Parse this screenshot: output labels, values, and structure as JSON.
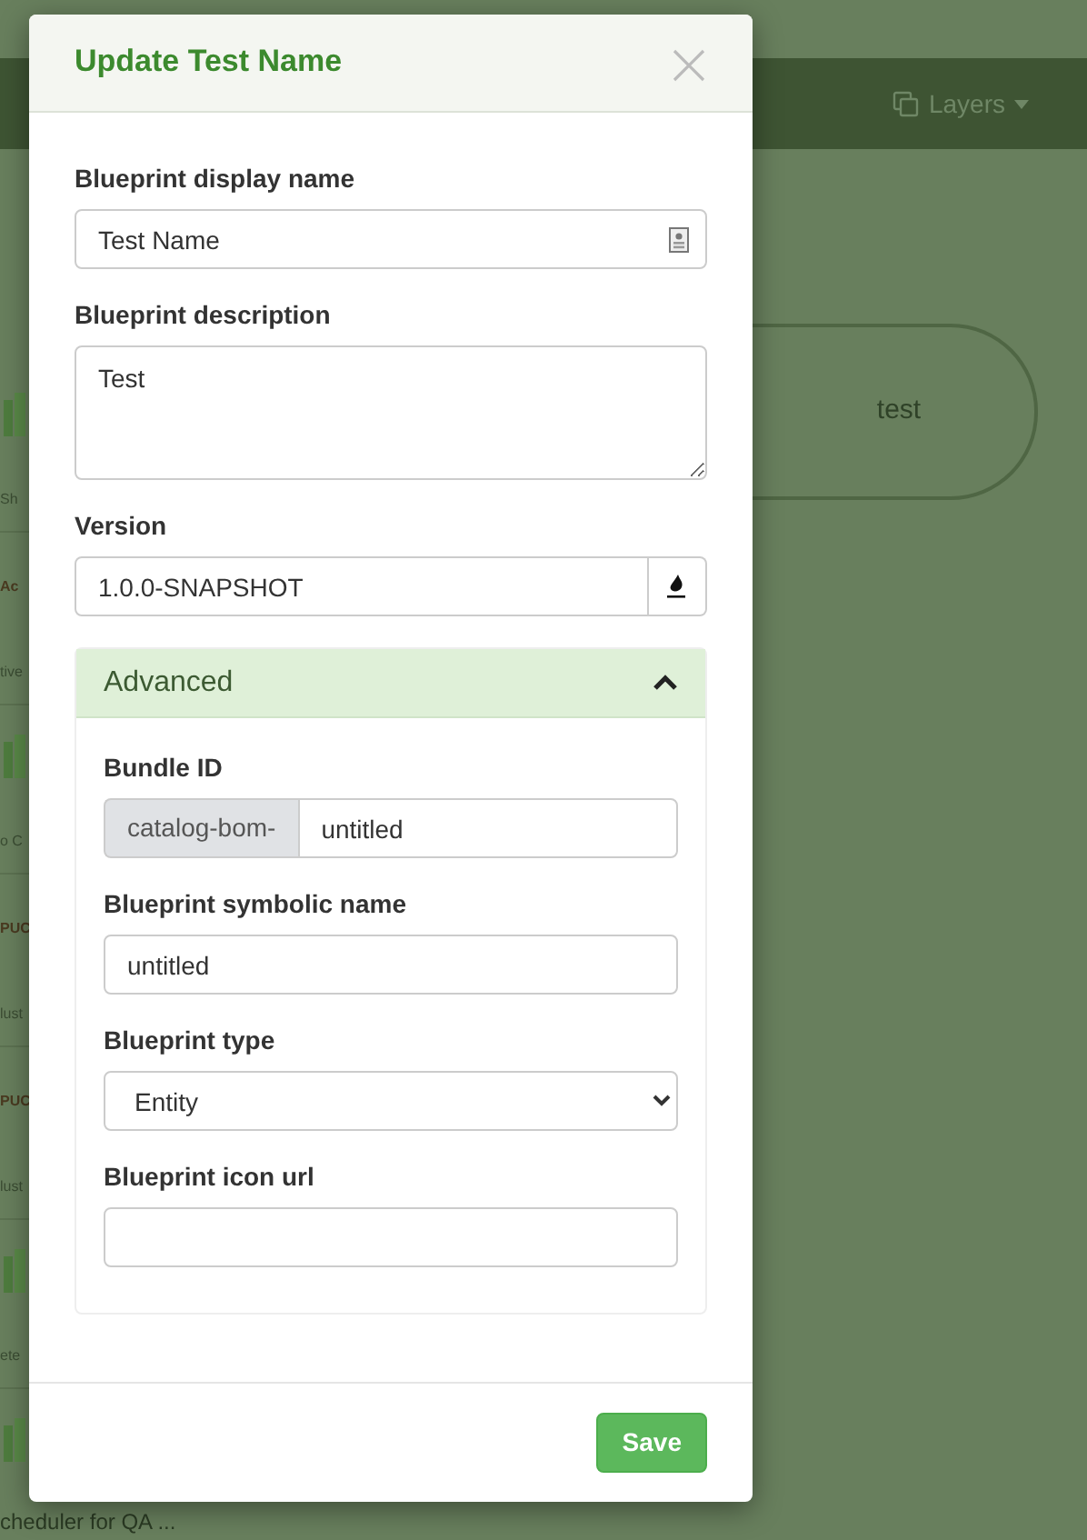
{
  "background": {
    "navbar": {
      "layers_menu": "Layers"
    },
    "sidebar_items": [
      {
        "kind": "icon"
      },
      {
        "kind": "text",
        "text": "Sh"
      },
      {
        "kind": "logo",
        "text": "Ac"
      },
      {
        "kind": "text",
        "text": "tive"
      },
      {
        "kind": "icon"
      },
      {
        "kind": "text",
        "text": "o C"
      },
      {
        "kind": "logo",
        "text": "PUC"
      },
      {
        "kind": "text",
        "text": "lust"
      },
      {
        "kind": "logo",
        "text": "PUC"
      },
      {
        "kind": "text",
        "text": "lust"
      },
      {
        "kind": "icon"
      },
      {
        "kind": "text",
        "text": "ete"
      },
      {
        "kind": "icon"
      },
      {
        "kind": "text",
        "text": "cheduler for QA ..."
      }
    ],
    "node": {
      "label": "test"
    }
  },
  "modal": {
    "title": "Update Test Name",
    "display_name": {
      "label": "Blueprint display name",
      "value": "Test Name"
    },
    "description": {
      "label": "Blueprint description",
      "value": "Test"
    },
    "version": {
      "label": "Version",
      "value": "1.0.0-SNAPSHOT"
    },
    "advanced": {
      "label": "Advanced",
      "expanded": true,
      "bundle_id": {
        "label": "Bundle ID",
        "prefix": "catalog-bom-",
        "value": "untitled"
      },
      "symbolic_name": {
        "label": "Blueprint symbolic name",
        "value": "untitled"
      },
      "type": {
        "label": "Blueprint type",
        "value": "Entity"
      },
      "icon_url": {
        "label": "Blueprint icon url"
      }
    },
    "save_button": "Save"
  }
}
